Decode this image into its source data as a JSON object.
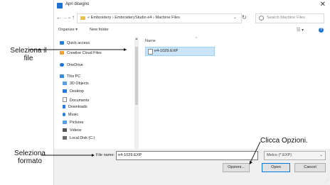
{
  "window": {
    "title": "Apri disegno",
    "close_glyph": "✕"
  },
  "nav": {
    "back": "←",
    "forward": "→",
    "recent": "⌄",
    "up": "↑",
    "address": "« Embroidery › EmbroideryStudio e4 › Machine Files",
    "address_dropdown": "⌄",
    "refresh": "↻",
    "search_placeholder": "Search Machine Files"
  },
  "toolbar": {
    "organize": "Organize ▾",
    "new_folder": "New folder",
    "view": "☷ ▾",
    "help": "?"
  },
  "sidebar": {
    "items": [
      {
        "label": "Quick access",
        "icon": "star-icon",
        "color": "#2a7bd3"
      },
      {
        "label": "Creative Cloud Files",
        "icon": "creative-cloud-icon",
        "color": "#e8a23a"
      },
      {
        "label": "OneDrive",
        "icon": "cloud-icon",
        "color": "#1e73d2"
      },
      {
        "label": "This PC",
        "icon": "computer-icon",
        "color": "#3d8ad6"
      },
      {
        "label": "3D Objects",
        "icon": "cube-icon",
        "color": "#5aa0de"
      },
      {
        "label": "Desktop",
        "icon": "desktop-icon",
        "color": "#2a7bd3"
      },
      {
        "label": "Documents",
        "icon": "document-icon",
        "color": "#8a8a8a"
      },
      {
        "label": "Downloads",
        "icon": "download-icon",
        "color": "#2a7bd3"
      },
      {
        "label": "Music",
        "icon": "music-icon",
        "color": "#2a7bd3"
      },
      {
        "label": "Pictures",
        "icon": "picture-icon",
        "color": "#5aa0de"
      },
      {
        "label": "Videos",
        "icon": "video-icon",
        "color": "#555555"
      },
      {
        "label": "Local Disk (C:)",
        "icon": "disk-icon",
        "color": "#6b6b6b"
      }
    ]
  },
  "content": {
    "column_header": "Name",
    "sort_glyph": "^",
    "files": [
      {
        "name": "e4-1029.EXP"
      }
    ]
  },
  "footer": {
    "file_name_label": "File name:",
    "file_name_value": "e4-1029.EXP",
    "filter_value": "Melco (*.EXP)",
    "filter_drop": "⌄",
    "options_label": "Opzioni...",
    "open_label": "Open",
    "cancel_label": "Cancel"
  },
  "annotations": {
    "select_file": [
      "Seleziona il",
      "file"
    ],
    "select_format": [
      "Seleziona",
      "formato"
    ],
    "click_options": "Clicca Opzioni."
  }
}
